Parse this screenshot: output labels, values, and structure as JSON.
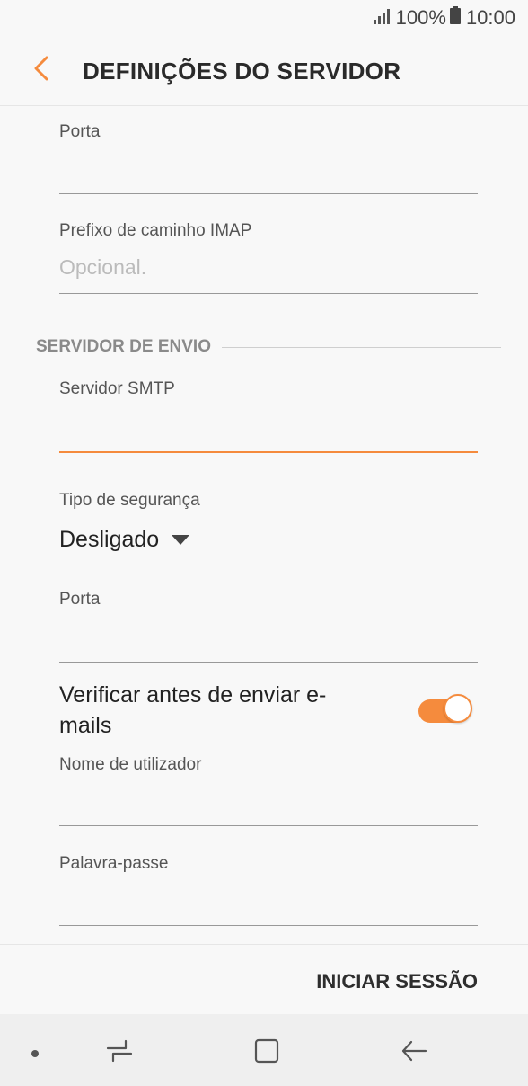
{
  "status": {
    "battery_percent": "100%",
    "time": "10:00",
    "icons": [
      "signal-icon",
      "battery-icon"
    ]
  },
  "header": {
    "title": "DEFINIÇÕES DO SERVIDOR",
    "back_icon": "chevron-left-icon"
  },
  "incoming": {
    "port_label": "Porta",
    "port_value": "",
    "imap_prefix_label": "Prefixo de caminho IMAP",
    "imap_prefix_placeholder": "Opcional."
  },
  "outgoing": {
    "section_title": "SERVIDOR DE ENVIO",
    "smtp_label": "Servidor SMTP",
    "smtp_value": "",
    "security_label": "Tipo de segurança",
    "security_value": "Desligado",
    "port_label": "Porta",
    "port_value": "",
    "verify_label": "Verificar antes de enviar e-mails",
    "verify_on": true,
    "username_label": "Nome de utilizador",
    "username_value": "",
    "password_label": "Palavra-passe",
    "password_value": ""
  },
  "footer": {
    "login_label": "INICIAR SESSÃO"
  },
  "nav": {
    "icons": [
      "dot-icon",
      "recent-apps-icon",
      "home-icon",
      "back-icon"
    ]
  },
  "colors": {
    "accent": "#f58b3d",
    "background": "#f8f8f8"
  }
}
